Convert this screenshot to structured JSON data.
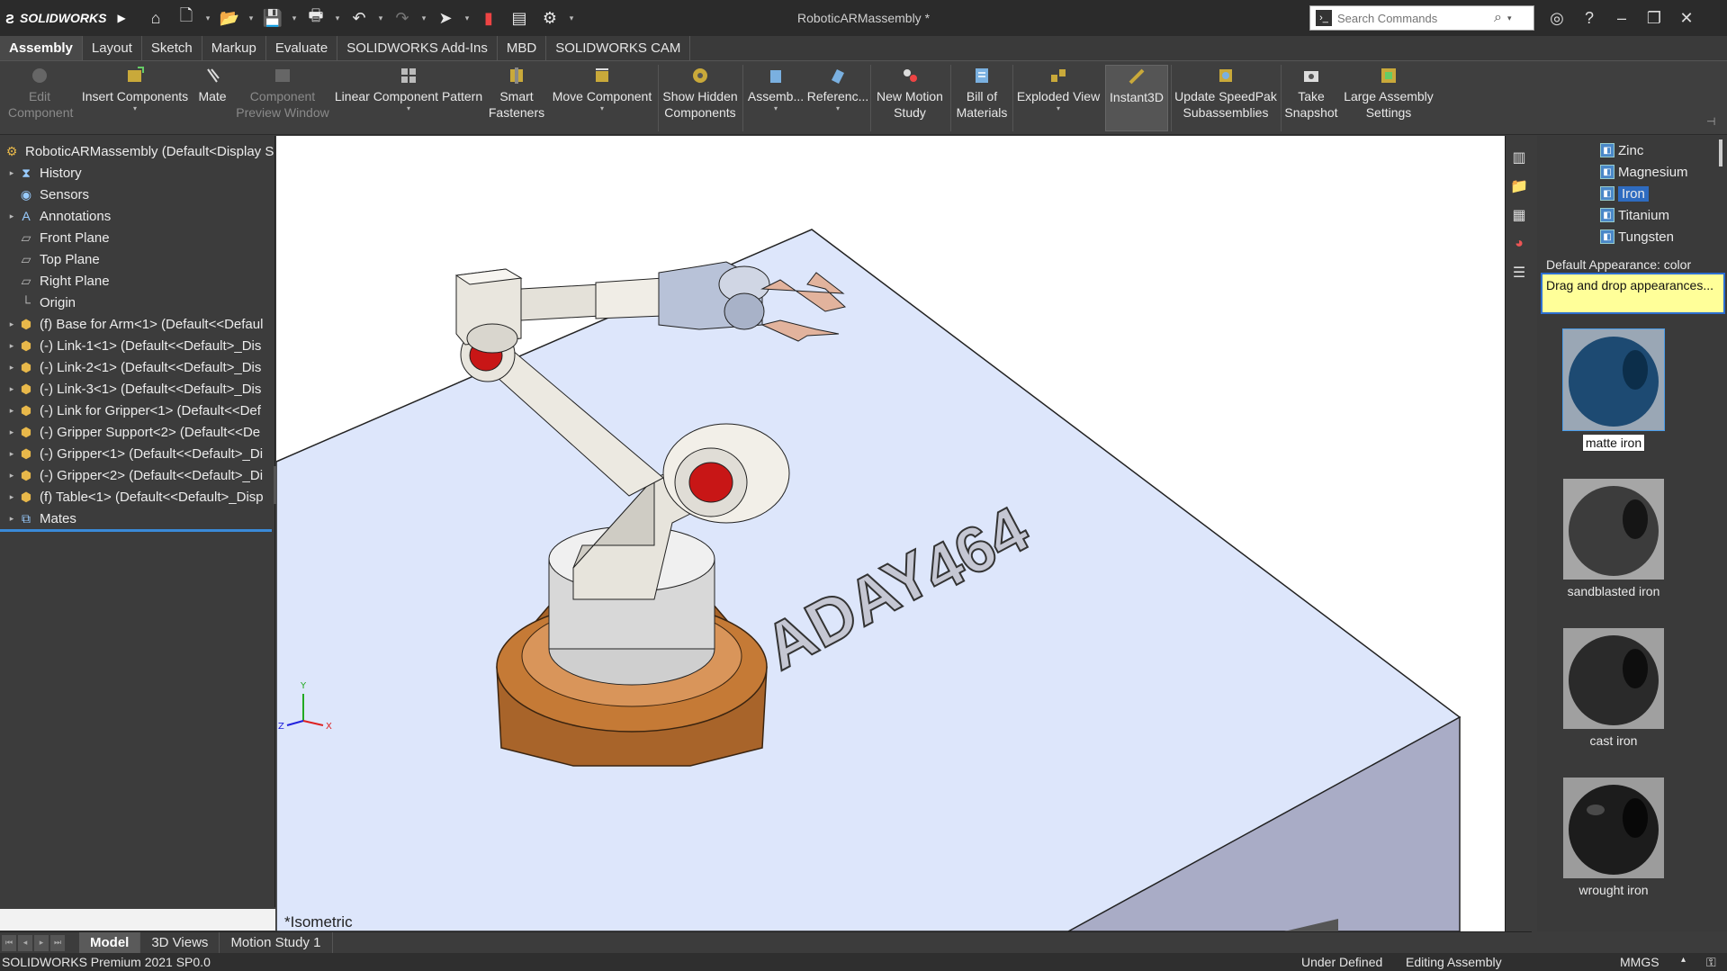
{
  "app": {
    "name": "SOLIDWORKS",
    "doc_title": "RoboticARMassembly *"
  },
  "search": {
    "placeholder": "Search Commands"
  },
  "tabs": [
    "Assembly",
    "Layout",
    "Sketch",
    "Markup",
    "Evaluate",
    "SOLIDWORKS Add-Ins",
    "MBD",
    "SOLIDWORKS CAM"
  ],
  "ribbon": {
    "edit_component": "Edit Component",
    "insert_components": "Insert Components",
    "mate": "Mate",
    "component_preview": "Component Preview Window",
    "linear_pattern": "Linear Component Pattern",
    "smart_fasteners": "Smart Fasteners",
    "move_component": "Move Component",
    "show_hidden": "Show Hidden Components",
    "assembly": "Assemb...",
    "reference": "Referenc...",
    "new_motion": "New Motion Study",
    "bom": "Bill of Materials",
    "exploded": "Exploded View",
    "instant3d": "Instant3D",
    "speedpak": "Update SpeedPak Subassemblies",
    "snapshot": "Take Snapshot",
    "large_assembly": "Large Assembly Settings"
  },
  "tree": {
    "root": "RoboticARMassembly  (Default<Display S",
    "items": [
      "History",
      "Sensors",
      "Annotations",
      "Front Plane",
      "Top Plane",
      "Right Plane",
      "Origin",
      "(f) Base for Arm<1> (Default<<Defaul",
      "(-) Link-1<1> (Default<<Default>_Dis",
      "(-) Link-2<1> (Default<<Default>_Dis",
      "(-) Link-3<1> (Default<<Default>_Dis",
      "(-) Link for Gripper<1> (Default<<Def",
      "(-) Gripper Support<2> (Default<<De",
      "(-) Gripper<1> (Default<<Default>_Di",
      "(-) Gripper<2> (Default<<Default>_Di",
      "(f) Table<1> (Default<<Default>_Disp",
      "Mates"
    ]
  },
  "viewport": {
    "view_label": "*Isometric",
    "engraved_text_1": "ADAY",
    "engraved_text_2": "464",
    "triad": {
      "x": "X",
      "y": "Y",
      "z": "Z"
    }
  },
  "taskpane": {
    "materials": [
      "Zinc",
      "Magnesium",
      "Iron",
      "Titanium",
      "Tungsten"
    ],
    "selected_material": "Iron",
    "appearance_header": "Default Appearance: color",
    "tooltip": "Drag and drop appearances...",
    "swatches": [
      "matte iron",
      "sandblasted iron",
      "cast iron",
      "wrought iron"
    ]
  },
  "bottom_tabs": [
    "Model",
    "3D Views",
    "Motion Study 1"
  ],
  "status": {
    "product": "SOLIDWORKS Premium 2021 SP0.0",
    "defined": "Under Defined",
    "mode": "Editing Assembly",
    "units": "MMGS"
  }
}
